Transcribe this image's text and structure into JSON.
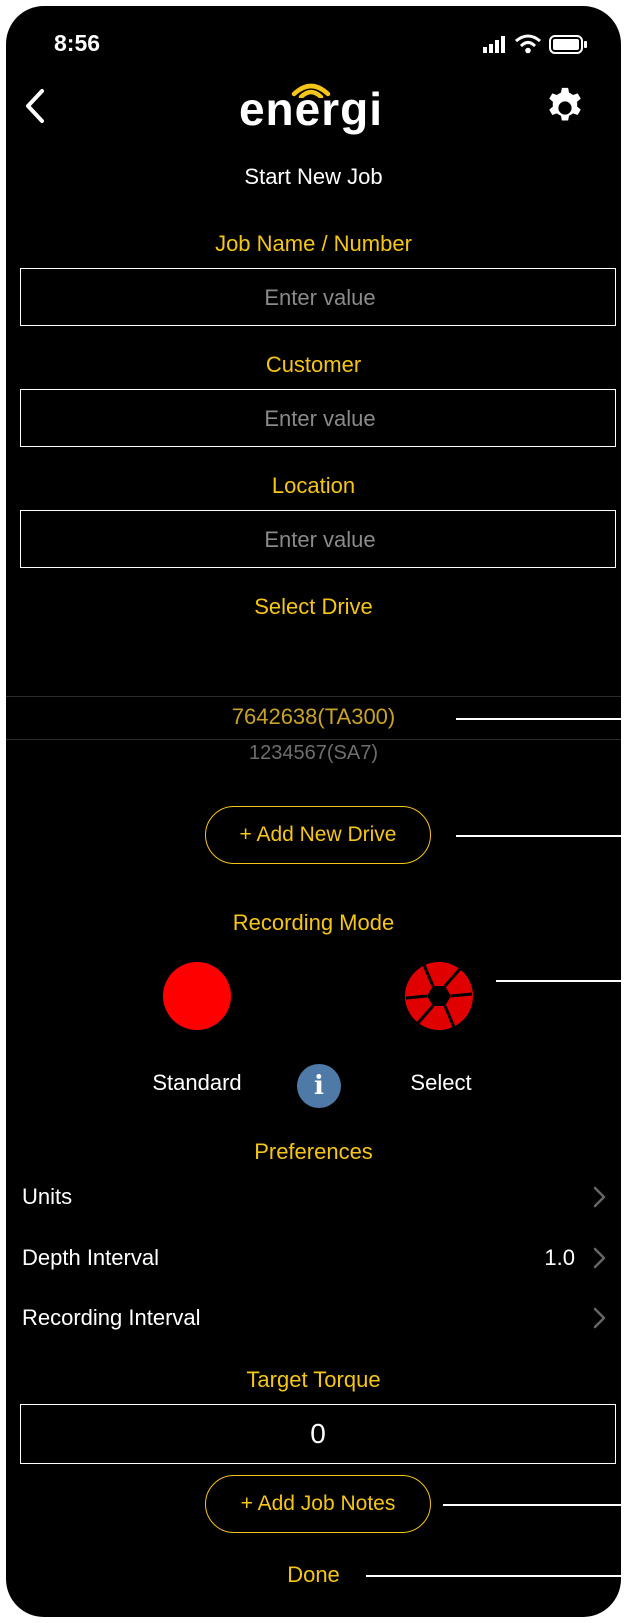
{
  "status": {
    "time": "8:56"
  },
  "header": {
    "logo_text": "energi",
    "title": "Start New Job"
  },
  "fields": {
    "job_name": {
      "label": "Job Name / Number",
      "placeholder": "Enter value"
    },
    "customer": {
      "label": "Customer",
      "placeholder": "Enter value"
    },
    "location": {
      "label": "Location",
      "placeholder": "Enter value"
    }
  },
  "drive": {
    "label": "Select Drive",
    "options": [
      "7642638(TA300)",
      "1234567(SA7)"
    ],
    "selected": "7642638(TA300)",
    "add_label": "+ Add New Drive"
  },
  "recording": {
    "label": "Recording Mode",
    "standard_label": "Standard",
    "select_label": "Select",
    "info_glyph": "i"
  },
  "preferences": {
    "label": "Preferences",
    "rows": [
      {
        "label": "Units",
        "value": ""
      },
      {
        "label": "Depth Interval",
        "value": "1.0"
      },
      {
        "label": "Recording Interval",
        "value": ""
      }
    ]
  },
  "torque": {
    "label": "Target Torque",
    "value": "0"
  },
  "actions": {
    "add_notes_label": "+ Add Job Notes",
    "done_label": "Done"
  },
  "colors": {
    "accent": "#f5c518",
    "record_red": "#ff0000",
    "info_blue": "#4f7aa8",
    "background": "#000000"
  },
  "icons": [
    "back-chevron-icon",
    "gear-icon",
    "signal-icon",
    "wifi-icon",
    "battery-icon",
    "record-dot-icon",
    "aperture-icon",
    "info-icon",
    "chevron-right-icon"
  ]
}
